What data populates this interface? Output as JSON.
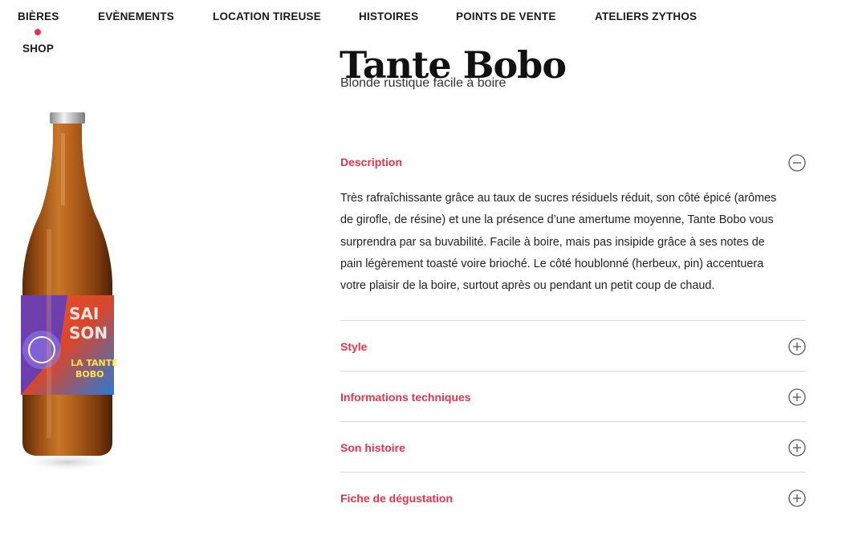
{
  "nav": {
    "items": [
      {
        "label": "BIÈRES",
        "active": true
      },
      {
        "label": "EVÈNEMENTS"
      },
      {
        "label": "LOCATION TIREUSE"
      },
      {
        "label": "HISTOIRES"
      },
      {
        "label": "POINTS DE VENTE"
      },
      {
        "label": "ATELIERS ZYTHOS"
      },
      {
        "label": "SHOP"
      }
    ],
    "active_color": "#e8334a"
  },
  "product": {
    "title": "Tante Bobo",
    "subtitle": "Blonde rustique facile à boire",
    "image": {
      "icon": "beer-bottle-image",
      "label_lines": [
        "SAI",
        "SON",
        "LA TANTE",
        "BOBO"
      ]
    }
  },
  "accordion": {
    "accent_color": "#e8334a",
    "sections": [
      {
        "title": "Description",
        "expanded": true,
        "icon": "minus-circle-icon",
        "body": "Très rafraîchissante grâce au taux de sucres résiduels réduit, son côté épicé (arômes de girofle, de résine) et une la présence d’une  amertume moyenne, Tante Bobo vous surprendra par sa buvabilité. Facile à boire, mais pas insipide grâce à ses notes de pain légèrement toasté voire brioché. Le côté houblonné (herbeux, pin) accentuera votre plaisir de la boire, surtout après ou pendant un petit coup de chaud."
      },
      {
        "title": "Style",
        "expanded": false,
        "icon": "plus-circle-icon"
      },
      {
        "title": "Informations techniques",
        "expanded": false,
        "icon": "plus-circle-icon"
      },
      {
        "title": "Son histoire",
        "expanded": false,
        "icon": "plus-circle-icon"
      },
      {
        "title": "Fiche de dégustation",
        "expanded": false,
        "icon": "plus-circle-icon"
      }
    ]
  }
}
